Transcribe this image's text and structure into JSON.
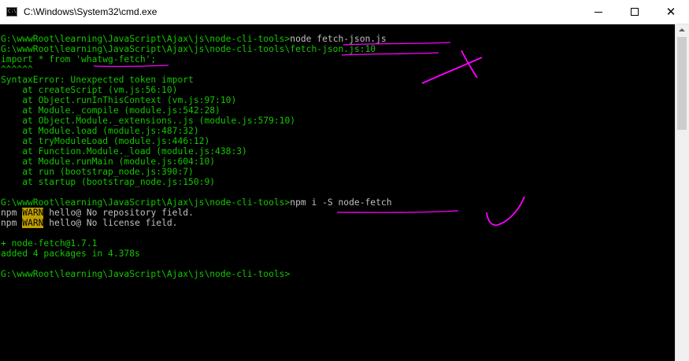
{
  "window": {
    "title": "C:\\Windows\\System32\\cmd.exe",
    "icon": "cmd-icon",
    "icon_text": "C:\\",
    "controls": {
      "minimize": "minimize-icon",
      "maximize": "maximize-icon",
      "close": "close-icon",
      "close_glyph": "✕"
    }
  },
  "console": {
    "text_color": "#c0c0c0",
    "prompt_color": "#13c600",
    "warn_bg": "#c1a000",
    "lines": [
      {
        "green": "G:\\wwwRoot\\learning\\JavaScript\\Ajax\\js\\node-cli-tools>",
        "text": "node fetch-json.js"
      },
      {
        "green": "G:\\wwwRoot\\learning\\JavaScript\\Ajax\\js\\node-cli-tools\\fetch-json.js:10",
        "text": ""
      },
      {
        "green": "import * from 'whatwg-fetch';",
        "text": ""
      },
      {
        "green": "^^^^^^",
        "text": ""
      },
      {
        "green": "SyntaxError: Unexpected token import",
        "text": ""
      },
      {
        "green": "    at createScript (vm.js:56:10)",
        "text": ""
      },
      {
        "green": "    at Object.runInThisContext (vm.js:97:10)",
        "text": ""
      },
      {
        "green": "    at Module._compile (module.js:542:28)",
        "text": ""
      },
      {
        "green": "    at Object.Module._extensions..js (module.js:579:10)",
        "text": ""
      },
      {
        "green": "    at Module.load (module.js:487:32)",
        "text": ""
      },
      {
        "green": "    at tryModuleLoad (module.js:446:12)",
        "text": ""
      },
      {
        "green": "    at Function.Module._load (module.js:438:3)",
        "text": ""
      },
      {
        "green": "    at Module.runMain (module.js:604:10)",
        "text": ""
      },
      {
        "green": "    at run (bootstrap_node.js:390:7)",
        "text": ""
      },
      {
        "green": "    at startup (bootstrap_node.js:150:9)",
        "text": ""
      },
      {
        "green": "",
        "text": ""
      },
      {
        "green": "G:\\wwwRoot\\learning\\JavaScript\\Ajax\\js\\node-cli-tools>",
        "text": "npm i -S node-fetch"
      },
      {
        "green": "",
        "text": "npm ",
        "warn": "WARN",
        "rest": " hello@ No repository field."
      },
      {
        "green": "",
        "text": "npm ",
        "warn": "WARN",
        "rest": " hello@ No license field."
      },
      {
        "green": "",
        "text": ""
      },
      {
        "green": "+ node-fetch@1.7.1",
        "text": ""
      },
      {
        "green": "added 4 packages in 4.378s",
        "text": ""
      },
      {
        "green": "",
        "text": ""
      },
      {
        "green": "G:\\wwwRoot\\learning\\JavaScript\\Ajax\\js\\node-cli-tools>",
        "text": ""
      }
    ]
  },
  "annotations": {
    "color": "#ff00ff",
    "cross_mark": "cross-mark",
    "check_mark": "check-mark"
  },
  "scrollbar": {
    "up_arrow": "scroll-up-icon"
  }
}
